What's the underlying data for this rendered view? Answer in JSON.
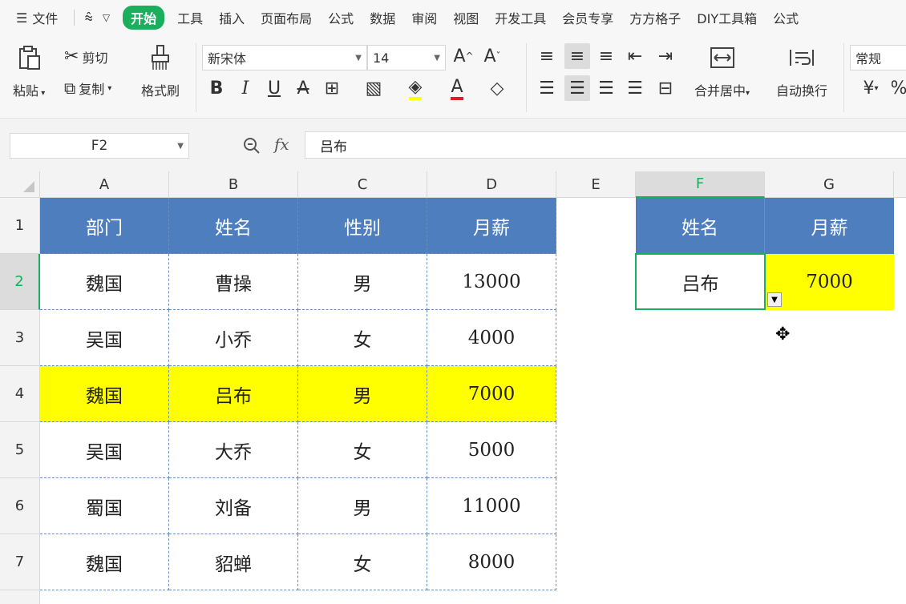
{
  "menubar": {
    "file_label": "文件",
    "tabs": [
      "开始",
      "工具",
      "插入",
      "页面布局",
      "公式",
      "数据",
      "审阅",
      "视图",
      "开发工具",
      "会员专享",
      "方方格子",
      "DIY工具箱",
      "公式"
    ],
    "active_tab": "开始"
  },
  "ribbon": {
    "paste": "粘贴",
    "cut": "剪切",
    "copy": "复制",
    "format_painter": "格式刷",
    "font_name": "新宋体",
    "font_size": "14",
    "merge_center": "合并居中",
    "wrap_text": "自动换行",
    "number_format": "常规",
    "currency_symbol": "¥"
  },
  "formula_bar": {
    "name_box": "F2",
    "fx": "fx",
    "content": "吕布"
  },
  "columns": [
    "A",
    "B",
    "C",
    "D",
    "E",
    "F",
    "G"
  ],
  "active_column": "F",
  "rows": [
    "1",
    "2",
    "3",
    "4",
    "5",
    "6",
    "7"
  ],
  "active_row": "2",
  "table": {
    "headers": [
      "部门",
      "姓名",
      "性别",
      "月薪"
    ],
    "rows": [
      [
        "魏国",
        "曹操",
        "男",
        "13000"
      ],
      [
        "吴国",
        "小乔",
        "女",
        "4000"
      ],
      [
        "魏国",
        "吕布",
        "男",
        "7000"
      ],
      [
        "吴国",
        "大乔",
        "女",
        "5000"
      ],
      [
        "蜀国",
        "刘备",
        "男",
        "11000"
      ],
      [
        "魏国",
        "貂蝉",
        "女",
        "8000"
      ]
    ],
    "highlight_row_index": 2
  },
  "lookup": {
    "headers": [
      "姓名",
      "月薪"
    ],
    "name": "吕布",
    "salary": "7000"
  },
  "colors": {
    "header_fill": "#4e7ebe",
    "highlight_fill": "#ffff00",
    "accent": "#1aae5d"
  }
}
